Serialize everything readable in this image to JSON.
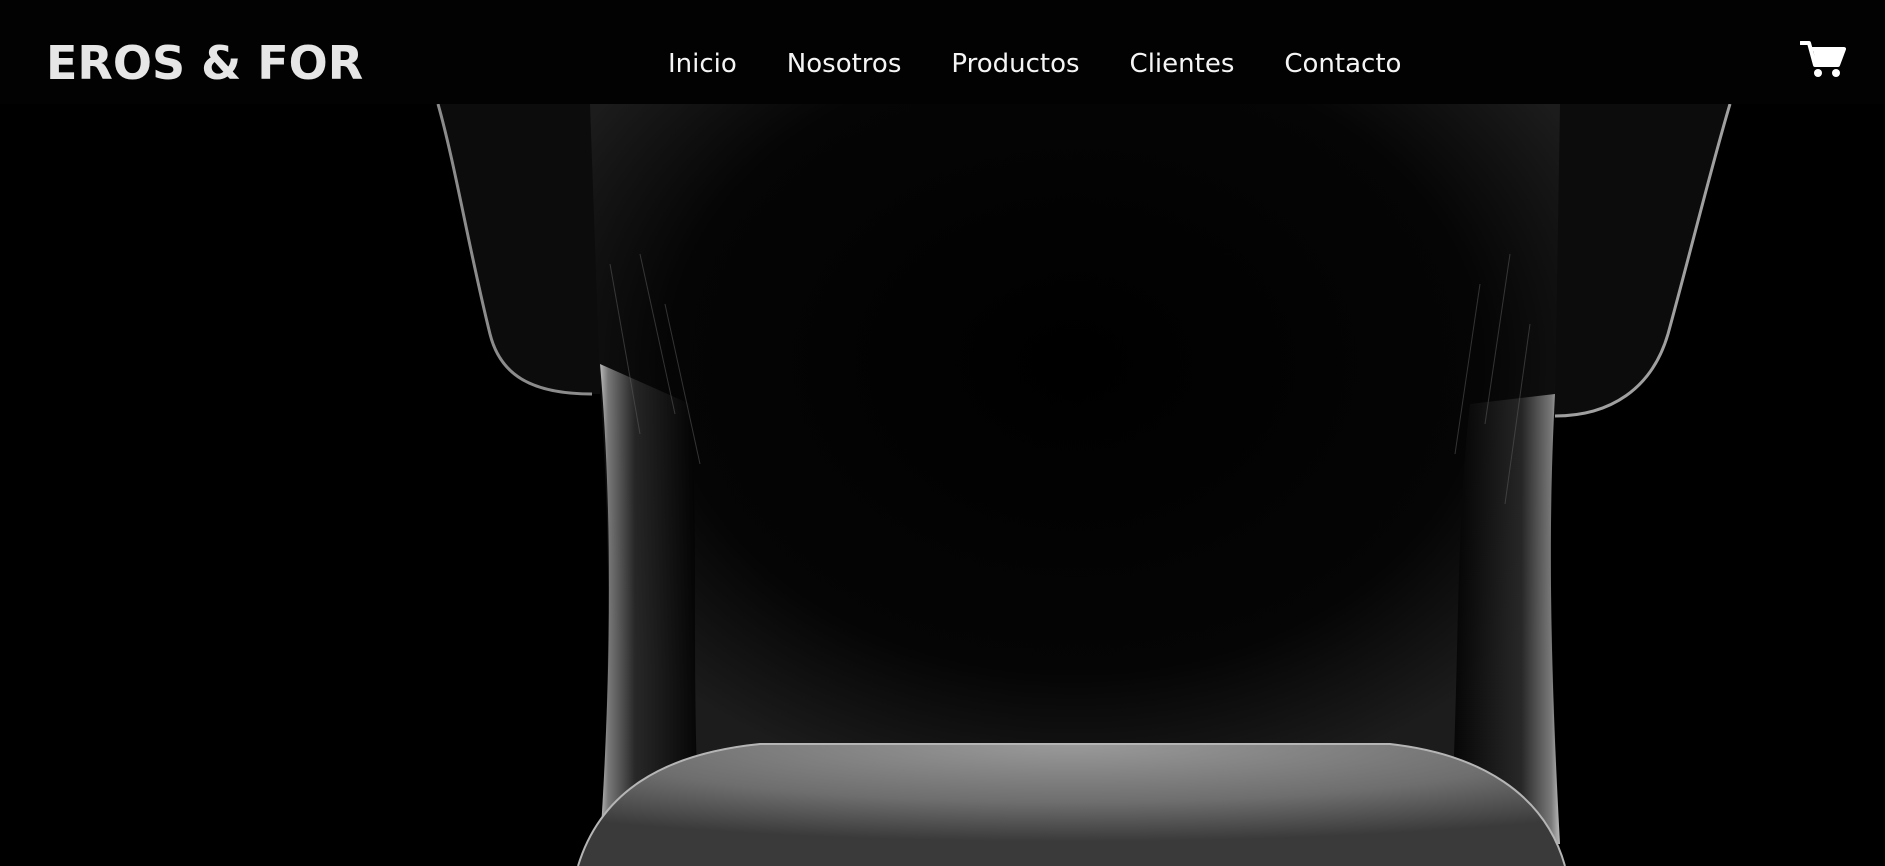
{
  "brand": {
    "name": "EROS & FOR"
  },
  "nav": {
    "items": [
      {
        "label": "Inicio"
      },
      {
        "label": "Nosotros"
      },
      {
        "label": "Productos"
      },
      {
        "label": "Clientes"
      },
      {
        "label": "Contacto"
      }
    ]
  },
  "header": {
    "cart_icon": "shopping-cart-icon"
  },
  "hero": {
    "image": "backlit-neck-black-and-white-photo"
  },
  "colors": {
    "background": "#000000",
    "brand_text": "#e6e6e6",
    "nav_text": "#f5f5f5"
  }
}
